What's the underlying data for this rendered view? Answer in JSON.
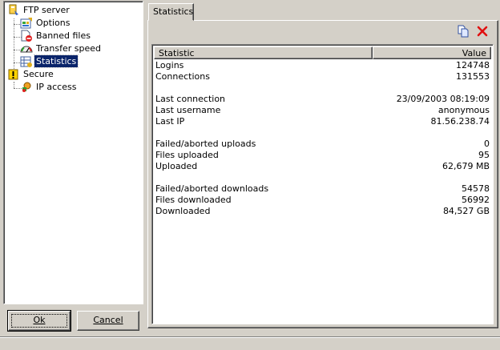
{
  "tree": {
    "items": [
      {
        "label": "FTP server",
        "icon": "ftp-server-icon"
      },
      {
        "label": "Options",
        "icon": "options-icon"
      },
      {
        "label": "Banned files",
        "icon": "banned-files-icon"
      },
      {
        "label": "Transfer speed",
        "icon": "speed-gauge-icon"
      },
      {
        "label": "Statistics",
        "icon": "statistics-icon",
        "selected": true
      },
      {
        "label": "Secure",
        "icon": "secure-icon"
      },
      {
        "label": "IP access",
        "icon": "ip-access-icon"
      }
    ]
  },
  "buttons": {
    "ok": "Ok",
    "cancel": "Cancel"
  },
  "tab": {
    "label": "Statistics"
  },
  "toolbar": {
    "copy_icon": "copy-icon",
    "clear_icon": "clear-icon"
  },
  "table": {
    "columns": [
      "Statistic",
      "Value"
    ],
    "rows": [
      {
        "k": "Logins",
        "v": "124748"
      },
      {
        "k": "Connections",
        "v": "131553"
      },
      {
        "k": "",
        "v": ""
      },
      {
        "k": "Last connection",
        "v": "23/09/2003 08:19:09"
      },
      {
        "k": "Last username",
        "v": "anonymous"
      },
      {
        "k": "Last IP",
        "v": "81.56.238.74"
      },
      {
        "k": "",
        "v": ""
      },
      {
        "k": "Failed/aborted uploads",
        "v": "0"
      },
      {
        "k": "Files uploaded",
        "v": "95"
      },
      {
        "k": "Uploaded",
        "v": "62,679 MB"
      },
      {
        "k": "",
        "v": ""
      },
      {
        "k": "Failed/aborted downloads",
        "v": "54578"
      },
      {
        "k": "Files downloaded",
        "v": "56992"
      },
      {
        "k": "Downloaded",
        "v": "84,527 GB"
      }
    ]
  },
  "colors": {
    "selection": "#0a246a",
    "face": "#d4d0c8",
    "red_x": "#e01010"
  }
}
